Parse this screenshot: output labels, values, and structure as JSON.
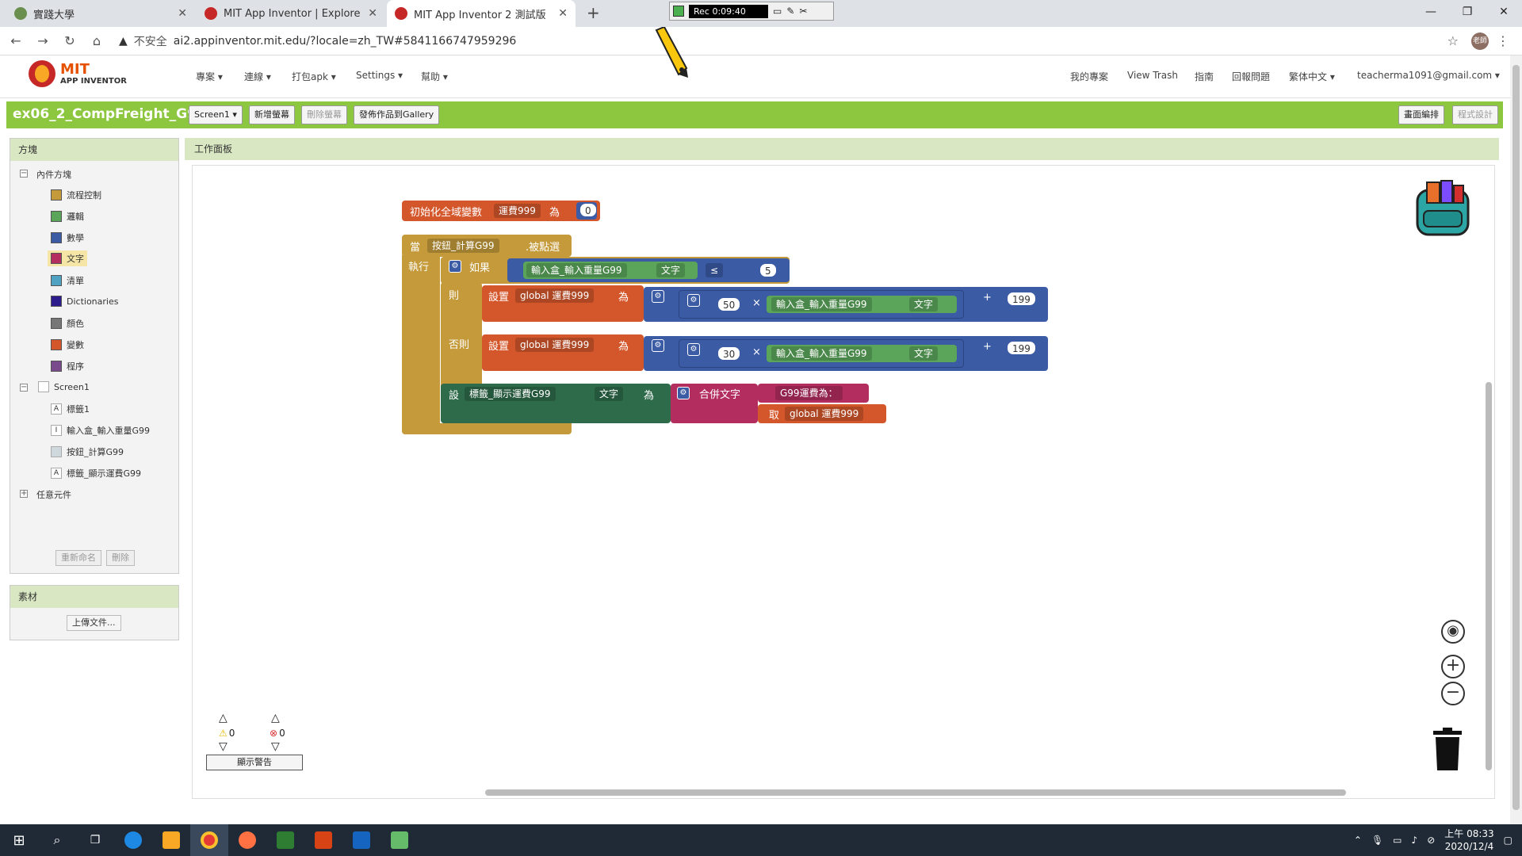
{
  "browser": {
    "tabs": [
      {
        "title": "實踐大學",
        "active": false
      },
      {
        "title": "MIT App Inventor | Explore MIT",
        "active": false
      },
      {
        "title": "MIT App Inventor 2 測試版",
        "active": true
      }
    ],
    "recorder_time": "Rec 0:09:40",
    "insecure_label": "不安全",
    "url": "ai2.appinventor.mit.edu/?locale=zh_TW#5841166747959296",
    "profile_initials": "老師"
  },
  "app_header": {
    "logo_line1": "MIT",
    "logo_line2": "APP INVENTOR",
    "menus": [
      "專案",
      "連線",
      "打包apk",
      "Settings",
      "幫助"
    ],
    "right_links": [
      "我的專案",
      "View Trash",
      "指南",
      "回報問題",
      "繁体中文",
      "teacherma1091@gmail.com"
    ]
  },
  "toolbar": {
    "project_name": "ex06_2_CompFreight_G99",
    "screen_select": "Screen1",
    "add_screen": "新增螢幕",
    "remove_screen": "刪除螢幕",
    "publish": "發佈作品到Gallery",
    "designer": "畫面編排",
    "blocks": "程式設計"
  },
  "blocks_panel": {
    "title": "方塊",
    "builtin": "內件方塊",
    "categories": [
      {
        "label": "流程控制",
        "color": "#c49a3a"
      },
      {
        "label": "邏輯",
        "color": "#5ba55b"
      },
      {
        "label": "數學",
        "color": "#3b5ba5"
      },
      {
        "label": "文字",
        "color": "#b32d5e"
      },
      {
        "label": "清單",
        "color": "#4fa2c2"
      },
      {
        "label": "Dictionaries",
        "color": "#2d1d8c"
      },
      {
        "label": "顏色",
        "color": "#777777"
      },
      {
        "label": "變數",
        "color": "#d4562b"
      },
      {
        "label": "程序",
        "color": "#7a4b8c"
      }
    ],
    "screen": "Screen1",
    "components": [
      "標籤1",
      "輸入盒_輸入重量G99",
      "按鈕_計算G99",
      "標籤_顯示運費G99"
    ],
    "any_component": "任意元件",
    "rename": "重新命名",
    "delete": "刪除"
  },
  "media_panel": {
    "title": "素材",
    "upload": "上傳文件..."
  },
  "workspace": {
    "title": "工作面板",
    "init_global": {
      "label": "初始化全域變數",
      "var": "運費999",
      "to": "為",
      "value": "0"
    },
    "when": {
      "label": "當",
      "component": "按鈕_計算G99",
      "event": ".被點選",
      "do": "執行"
    },
    "if": {
      "label": "如果",
      "component": "輸入盒_輸入重量G99",
      "prop": "文字",
      "op": "≤",
      "value": "5"
    },
    "then": {
      "label": "則",
      "set": "設置",
      "var": "global 運費999",
      "to": "為",
      "mult": "50",
      "times": "×",
      "component": "輸入盒_輸入重量G99",
      "prop": "文字",
      "plus": "+",
      "add": "199"
    },
    "else": {
      "label": "否則",
      "set": "設置",
      "var": "global 運費999",
      "to": "為",
      "mult": "30",
      "times": "×",
      "component": "輸入盒_輸入重量G99",
      "prop": "文字",
      "plus": "+",
      "add": "199"
    },
    "set_label": {
      "set": "設",
      "component": "標籤_顯示運費G99",
      "prop": "文字",
      "to": "為",
      "join": "合併文字",
      "text": "G99運費為：",
      "get": "取",
      "var": "global 運費999"
    },
    "warnings_count": "0",
    "errors_count": "0",
    "show_warnings": "顯示警告"
  },
  "taskbar": {
    "time": "上午 08:33",
    "date": "2020/12/4"
  }
}
